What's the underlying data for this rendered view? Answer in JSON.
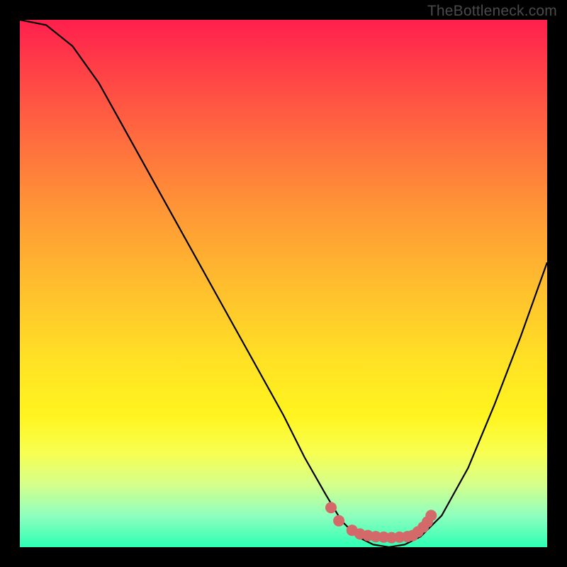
{
  "watermark": "TheBottleneck.com",
  "colors": {
    "background": "#000000",
    "curve": "#000000",
    "markers": "#d4696a"
  },
  "chart_data": {
    "type": "line",
    "title": "",
    "xlabel": "",
    "ylabel": "",
    "xlim": [
      0,
      100
    ],
    "ylim": [
      0,
      100
    ],
    "series": [
      {
        "name": "bottleneck-curve",
        "x": [
          0,
          5,
          10,
          15,
          20,
          25,
          30,
          35,
          40,
          45,
          50,
          54,
          58,
          61,
          64,
          67,
          70,
          73,
          76,
          80,
          85,
          90,
          95,
          100
        ],
        "y": [
          100,
          99,
          95,
          88,
          79,
          70,
          61,
          52,
          43,
          34,
          25,
          17,
          10,
          5,
          2,
          0.5,
          0,
          0.5,
          2,
          6,
          15,
          27,
          40,
          54
        ]
      }
    ],
    "markers": {
      "name": "highlight-dots",
      "points": [
        {
          "x": 59,
          "y": 7.5
        },
        {
          "x": 60.5,
          "y": 5
        },
        {
          "x": 63,
          "y": 3.2
        },
        {
          "x": 64.5,
          "y": 2.5
        },
        {
          "x": 66,
          "y": 2.2
        },
        {
          "x": 67.5,
          "y": 2.0
        },
        {
          "x": 69,
          "y": 1.9
        },
        {
          "x": 70.5,
          "y": 1.8
        },
        {
          "x": 72,
          "y": 1.9
        },
        {
          "x": 73.5,
          "y": 2.0
        },
        {
          "x": 74.5,
          "y": 2.2
        },
        {
          "x": 75.5,
          "y": 2.9
        },
        {
          "x": 76.5,
          "y": 3.8
        },
        {
          "x": 77.3,
          "y": 4.8
        },
        {
          "x": 78,
          "y": 6.0
        }
      ]
    }
  }
}
